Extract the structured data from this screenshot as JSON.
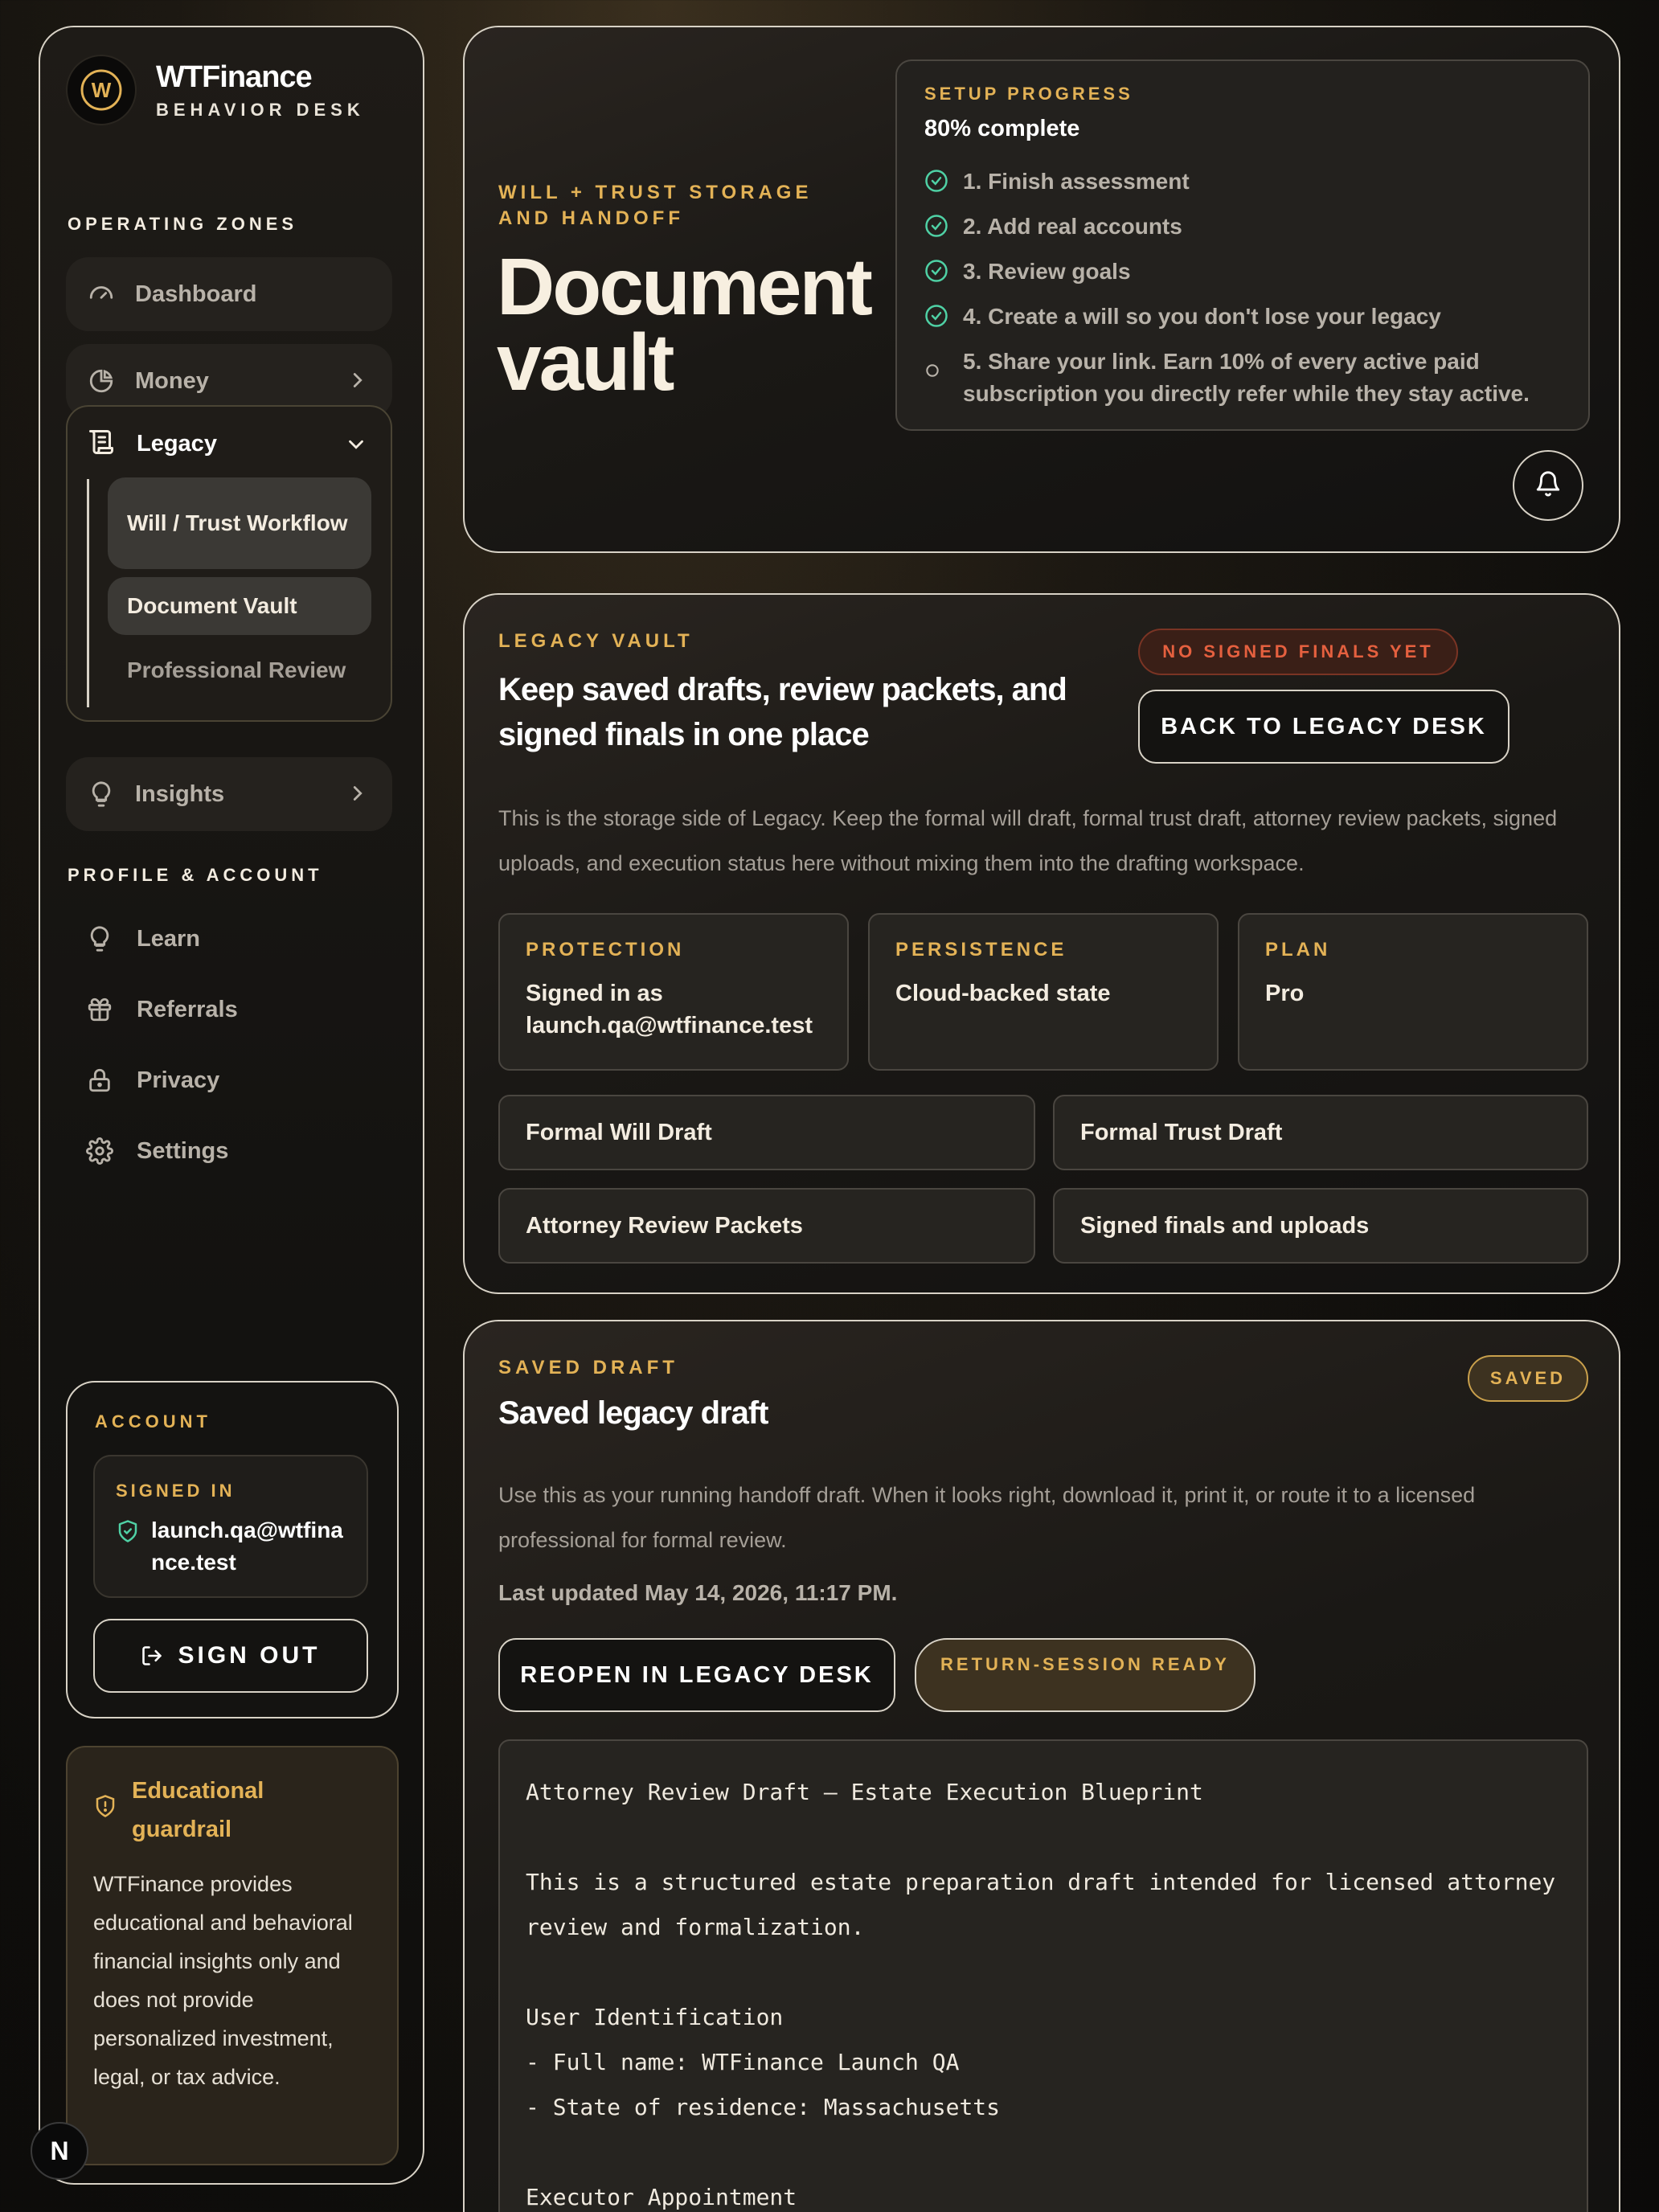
{
  "brand": {
    "name": "WTFinance",
    "subtitle": "BEHAVIOR DESK",
    "logo_letter": "W"
  },
  "sidebar": {
    "zones_label": "OPERATING ZONES",
    "dashboard": "Dashboard",
    "money": "Money",
    "legacy": "Legacy",
    "legacy_items": [
      "Will / Trust Workflow",
      "Document Vault",
      "Professional Review"
    ],
    "insights": "Insights",
    "profile_label": "PROFILE & ACCOUNT",
    "profile_items": [
      "Learn",
      "Referrals",
      "Privacy",
      "Settings"
    ]
  },
  "account": {
    "label": "ACCOUNT",
    "signed_in_label": "SIGNED IN",
    "email": "launch.qa@wtfinance.test",
    "sign_out": "SIGN OUT"
  },
  "guardrail": {
    "title": "Educational guardrail",
    "text": "WTFinance provides educational and behavioral financial insights only and does not provide personalized investment, legal, or tax advice."
  },
  "next_badge": "N",
  "hero": {
    "eyebrow": "WILL + TRUST STORAGE AND HANDOFF",
    "title_line1": "Document",
    "title_line2": "vault"
  },
  "setup": {
    "label": "SETUP PROGRESS",
    "progress_text": "80% complete",
    "progress": 0.8,
    "steps": [
      {
        "text": "1. Finish assessment",
        "done": true
      },
      {
        "text": "2. Add real accounts",
        "done": true
      },
      {
        "text": "3. Review goals",
        "done": true
      },
      {
        "text": "4. Create a will so you don't lose your legacy",
        "done": true
      },
      {
        "text": "5. Share your link. Earn 10% of every active paid subscription you directly refer while they stay active.",
        "done": false
      }
    ]
  },
  "vault": {
    "eyebrow": "LEGACY VAULT",
    "title": "Keep saved drafts, review packets, and signed finals in one place",
    "status_badge": "NO SIGNED FINALS YET",
    "back_button": "BACK TO LEGACY DESK",
    "description": "This is the storage side of Legacy. Keep the formal will draft, formal trust draft, attorney review packets, signed uploads, and execution status here without mixing them into the drafting workspace.",
    "cards": [
      {
        "label": "PROTECTION",
        "value": "Signed in as launch.qa@wtfinance.test"
      },
      {
        "label": "PERSISTENCE",
        "value": "Cloud-backed state"
      },
      {
        "label": "PLAN",
        "value": "Pro"
      }
    ],
    "documents": [
      "Formal Will Draft",
      "Formal Trust Draft",
      "Attorney Review Packets",
      "Signed finals and uploads"
    ]
  },
  "draft": {
    "eyebrow": "SAVED DRAFT",
    "title": "Saved legacy draft",
    "badge": "SAVED",
    "description": "Use this as your running handoff draft. When it looks right, download it, print it, or route it to a licensed professional for formal review.",
    "last_updated": "Last updated May 14, 2026, 11:17 PM.",
    "reopen_button": "REOPEN IN LEGACY DESK",
    "ready_badge": "RETURN-SESSION READY",
    "content": "Attorney Review Draft — Estate Execution Blueprint\n\nThis is a structured estate preparation draft intended for licensed attorney\nreview and formalization.\n\nUser Identification\n- Full name: WTFinance Launch QA\n- State of residence: Massachusetts\n\nExecutor Appointment"
  },
  "colors": {
    "accent": "#e3b256",
    "success": "#4fd1a5",
    "danger": "#e5603f",
    "border": "#d8d2c6"
  }
}
